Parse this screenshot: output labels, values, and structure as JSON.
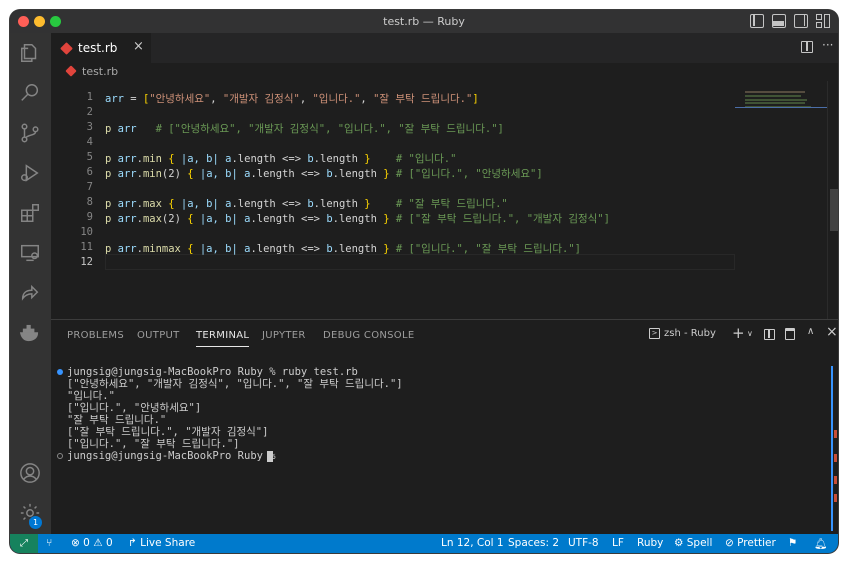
{
  "window": {
    "title": "test.rb — Ruby"
  },
  "tab": {
    "label": "test.rb"
  },
  "breadcrumb": {
    "file": "test.rb"
  },
  "editor": {
    "line_numbers": [
      "1",
      "2",
      "3",
      "4",
      "5",
      "6",
      "7",
      "8",
      "9",
      "10",
      "11",
      "12"
    ],
    "current_line": "12",
    "lines": {
      "l1": {
        "a": "arr",
        "b": " = ",
        "c": "[",
        "d": "\"안녕하세요\"",
        "e": ", ",
        "f": "\"개발자 김정식\"",
        "g": ", ",
        "h": "\"입니다.\"",
        "i": ", ",
        "j": "\"잘 부탁 드립니다.\"",
        "k": "]"
      },
      "l3": {
        "a": "p ",
        "b": "arr",
        "c": "   # [\"안녕하세요\", \"개발자 김정식\", \"입니다.\", \"잘 부탁 드립니다.\"]"
      },
      "l5": {
        "a": "p ",
        "b": "arr",
        "c": ".",
        "d": "min",
        "e": " { ",
        "f": "|a, b| ",
        "g": "a",
        "h": ".length <=> ",
        "i": "b",
        "j": ".length ",
        "k": "}",
        "l": "    # \"입니다.\""
      },
      "l6": {
        "a": "p ",
        "b": "arr",
        "c": ".",
        "d": "min",
        "e": "(2) ",
        "f": "{",
        "g": " |a, b| ",
        "h": "a",
        "i": ".length <=> ",
        "j": "b",
        "k": ".length ",
        "l": "}",
        "m": " # [\"입니다.\", \"안녕하세요\"]"
      },
      "l8": {
        "a": "p ",
        "b": "arr",
        "c": ".",
        "d": "max",
        "e": " { ",
        "f": "|a, b| ",
        "g": "a",
        "h": ".length <=> ",
        "i": "b",
        "j": ".length ",
        "k": "}",
        "l": "    # \"잘 부탁 드립니다.\""
      },
      "l9": {
        "a": "p ",
        "b": "arr",
        "c": ".",
        "d": "max",
        "e": "(2) ",
        "f": "{",
        "g": " |a, b| ",
        "h": "a",
        "i": ".length <=> ",
        "j": "b",
        "k": ".length ",
        "l": "}",
        "m": " # [\"잘 부탁 드립니다.\", \"개발자 김정식\"]"
      },
      "l11": {
        "a": "p ",
        "b": "arr",
        "c": ".",
        "d": "minmax",
        "e": " { ",
        "f": "|a, b| ",
        "g": "a",
        "h": ".length <=> ",
        "i": "b",
        "j": ".length ",
        "k": "}",
        "l": " # [\"입니다.\", \"잘 부탁 드립니다.\"]"
      }
    }
  },
  "panel": {
    "tabs": [
      "PROBLEMS",
      "OUTPUT",
      "TERMINAL",
      "JUPYTER",
      "DEBUG CONSOLE"
    ],
    "active_tab": "TERMINAL",
    "terminal_name": "zsh - Ruby",
    "terminal_lines": [
      "jungsig@jungsig-MacBookPro Ruby % ruby test.rb",
      "[\"안녕하세요\", \"개발자 김정식\", \"입니다.\", \"잘 부탁 드립니다.\"]",
      "\"입니다.\"",
      "[\"입니다.\", \"안녕하세요\"]",
      "\"잘 부탁 드립니다.\"",
      "[\"잘 부탁 드립니다.\", \"개발자 김정식\"]",
      "[\"입니다.\", \"잘 부탁 드립니다.\"]",
      "jungsig@jungsig-MacBookPro Ruby % "
    ]
  },
  "statusbar": {
    "errors": "0",
    "warnings": "0",
    "live_share": "Live Share",
    "position": "Ln 12, Col 1",
    "spaces": "Spaces: 2",
    "encoding": "UTF-8",
    "eol": "LF",
    "language": "Ruby",
    "spell": "Spell",
    "prettier": "Prettier"
  },
  "activity": {
    "settings_badge": "1"
  },
  "colors": {
    "accent": "#007acc",
    "remote": "#16825d",
    "ruby": "#e0443c"
  }
}
